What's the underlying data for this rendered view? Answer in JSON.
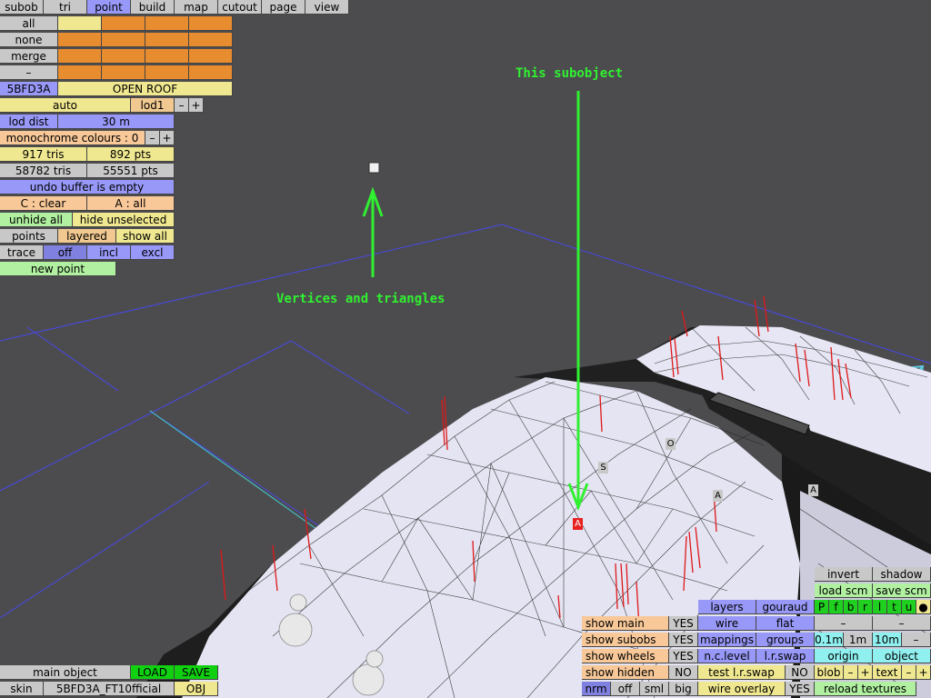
{
  "menu": {
    "tabs": [
      "subob",
      "tri",
      "point",
      "build",
      "map",
      "cutout",
      "page",
      "view"
    ],
    "active": "point"
  },
  "panel": {
    "all": "all",
    "none": "none",
    "merge": "merge",
    "dash": "–",
    "id": "5BFD3A",
    "name": "OPEN ROOF",
    "auto": "auto",
    "lod": "lod1",
    "minus": "–",
    "plus": "+",
    "lod_dist_label": "lod dist",
    "lod_dist_value": "30 m",
    "mono": "monochrome colours : 0",
    "tris": "917 tris",
    "pts": "892 pts",
    "tris_total": "58782 tris",
    "pts_total": "55551 pts",
    "undo": "undo buffer is empty",
    "c_clear": "C : clear",
    "a_all": "A : all",
    "unhide_all": "unhide all",
    "hide_unselected": "hide unselected",
    "points": "points",
    "layered": "layered",
    "show_all": "show all",
    "trace": "trace",
    "off": "off",
    "incl": "incl",
    "excl": "excl",
    "new_point": "new point"
  },
  "annotations": {
    "subobject": "This subobject",
    "vertices": "Vertices and triangles"
  },
  "scene_labels": {
    "o": "O",
    "s": "S",
    "a1": "A",
    "a2": "A",
    "a_sel": "A"
  },
  "bottom_left": {
    "main_object": "main object",
    "load": "LOAD",
    "save": "SAVE",
    "skin": "skin",
    "skin_name": "5BFD3A_FT10fficial",
    "obj": "OBJ"
  },
  "bottom_mid": {
    "show_main": "show main",
    "show_main_v": "YES",
    "show_subobs": "show subobs",
    "show_subobs_v": "YES",
    "show_wheels": "show wheels",
    "show_wheels_v": "YES",
    "show_hidden": "show hidden",
    "show_hidden_v": "NO",
    "nrm": "nrm",
    "off": "off",
    "sml": "sml",
    "big": "big"
  },
  "bottom_right": {
    "invert": "invert",
    "shadow": "shadow",
    "load_scm": "load scm",
    "save_scm": "save scm",
    "modes": [
      "P",
      "f",
      "b",
      "r",
      "l",
      "t",
      "u"
    ],
    "dot": "●",
    "layers": "layers",
    "gouraud": "gouraud",
    "wire": "wire",
    "flat": "flat",
    "mappings": "mappings",
    "groups": "groups",
    "n_c_level": "n.c.level",
    "l_r_swap": "l.r.swap",
    "test_lr_swap": "test l.r.swap",
    "test_lr_swap_v": "NO",
    "wire_overlay": "wire overlay",
    "wire_overlay_v": "YES",
    "dash1": "–",
    "dash2": "–",
    "d01": "0.1m",
    "d1": "1m",
    "d10": "10m",
    "dm": "–",
    "origin": "origin",
    "object": "object",
    "blob": "blob",
    "blob_minus": "–",
    "blob_plus": "+",
    "text": "text",
    "text_minus": "–",
    "text_plus": "+",
    "reload": "reload textures"
  }
}
